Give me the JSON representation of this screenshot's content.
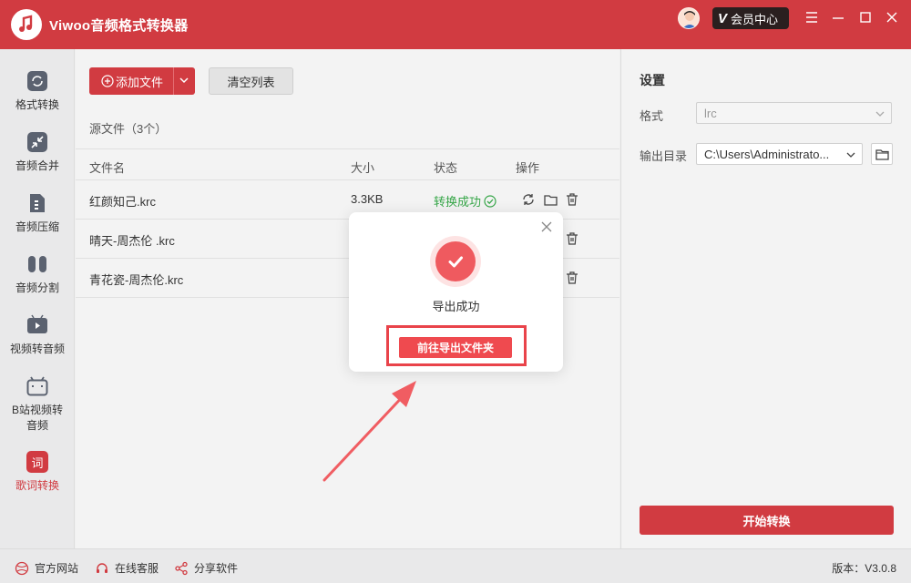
{
  "app": {
    "title": "Viwoo音频格式转换器",
    "vip_label": "会员中心",
    "brand_color": "#d13b41"
  },
  "sidebar": {
    "items": [
      {
        "label": "格式转换",
        "icon": "format-convert-icon"
      },
      {
        "label": "音频合并",
        "icon": "merge-icon"
      },
      {
        "label": "音频压缩",
        "icon": "compress-icon"
      },
      {
        "label": "音频分割",
        "icon": "split-icon"
      },
      {
        "label": "视频转音频",
        "icon": "video-icon"
      },
      {
        "label": "B站视频转音频",
        "line1": "B站视频转",
        "line2": "音频",
        "icon": "bilibili-icon"
      },
      {
        "label": "歌词转换",
        "icon_text": "词",
        "icon": "lyrics-icon",
        "active": true
      }
    ]
  },
  "toolbar": {
    "add_label": "添加文件",
    "clear_label": "清空列表"
  },
  "files": {
    "source_label": "源文件（3个）",
    "columns": [
      "文件名",
      "大小",
      "状态",
      "操作"
    ],
    "rows": [
      {
        "name": "红颜知己.krc",
        "size": "3.3KB",
        "status": "转换成功"
      },
      {
        "name": "晴天-周杰伦 .krc",
        "size": "",
        "status": ""
      },
      {
        "name": "青花瓷-周杰伦.krc",
        "size": "",
        "status": ""
      }
    ]
  },
  "settings": {
    "title": "设置",
    "format_label": "格式",
    "format_value": "lrc",
    "output_label": "输出目录",
    "output_value": "C:\\Users\\Administrato...",
    "start_label": "开始转换"
  },
  "footer": {
    "website": "官方网站",
    "support": "在线客服",
    "share": "分享软件",
    "version": "版本：V3.0.8"
  },
  "modal": {
    "message": "导出成功",
    "button_label": "前往导出文件夹"
  }
}
